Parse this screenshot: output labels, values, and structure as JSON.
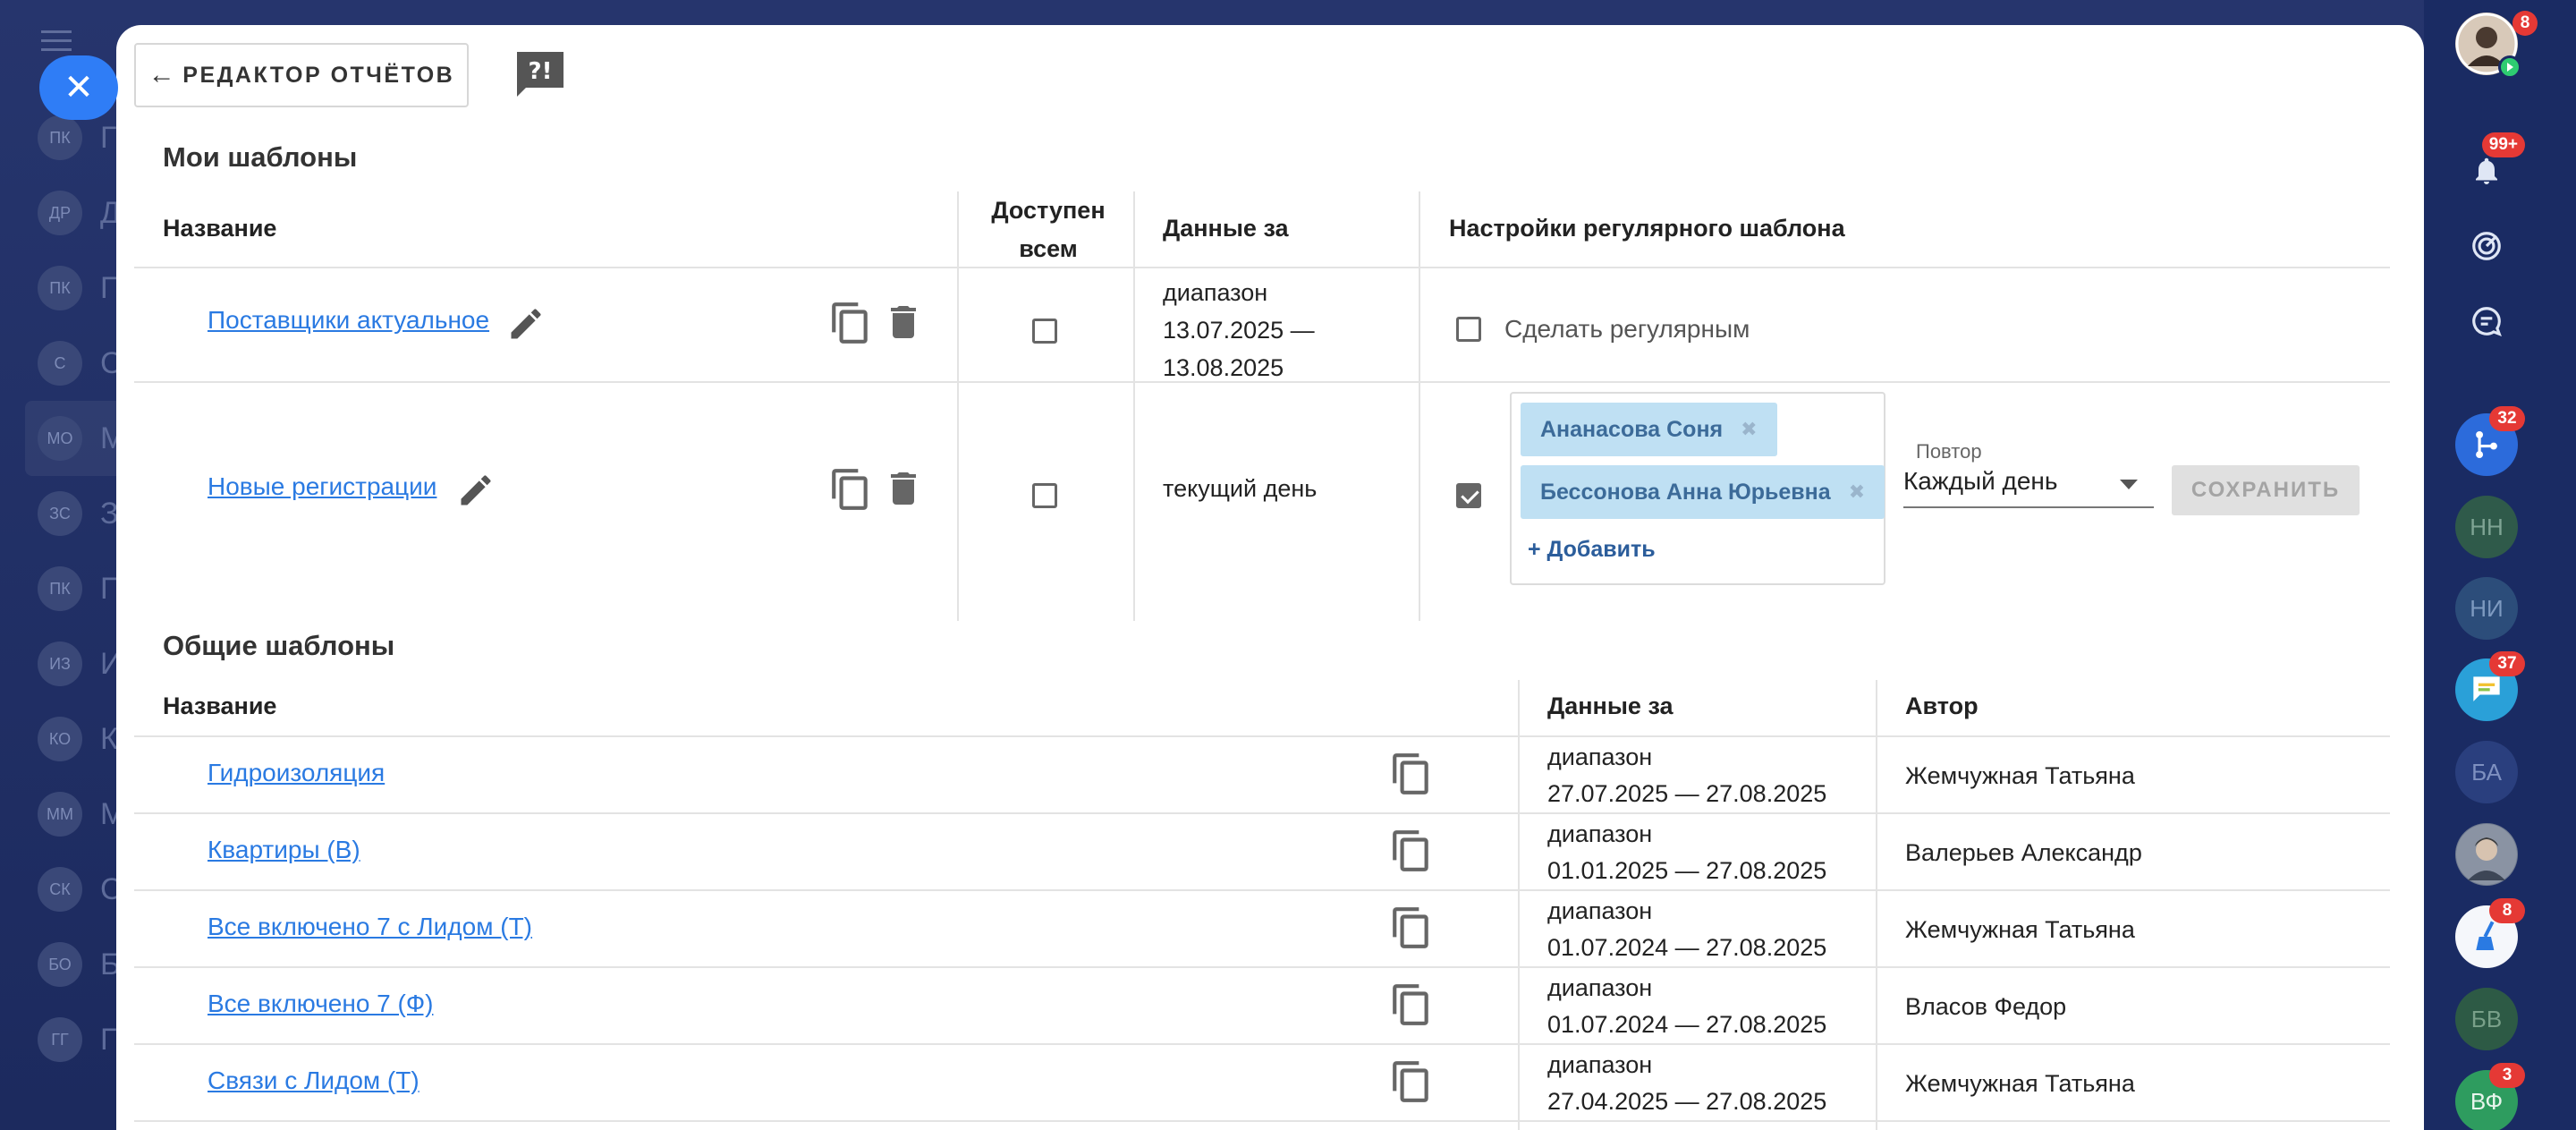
{
  "back_button": {
    "label": "РЕДАКТОР ОТЧЁТОВ"
  },
  "my_templates": {
    "title": "Мои шаблоны",
    "headers": {
      "name": "Название",
      "available": "Доступен всем",
      "data_for": "Данные за",
      "regular": "Настройки регулярного шаблона"
    },
    "rows": [
      {
        "name": "Поставщики актуальное",
        "data_for_lines": [
          "диапазон",
          "13.07.2025 —",
          "13.08.2025"
        ],
        "available": false,
        "regular_checked": false,
        "regular_label": "Сделать регулярным"
      },
      {
        "name": "Новые регистрации ",
        "data_for_lines": [
          "текущий день"
        ],
        "available": false,
        "regular_checked": true,
        "recipients": [
          "Ананасова Соня",
          "Бессонова Анна Юрьевна"
        ],
        "add_label": "+ Добавить",
        "repeat_label": "Повтор",
        "repeat_value": "Каждый день",
        "save_label": "СОХРАНИТЬ"
      }
    ]
  },
  "common_templates": {
    "title": "Общие шаблоны",
    "headers": {
      "name": "Название",
      "data_for": "Данные за",
      "author": "Автор"
    },
    "rows": [
      {
        "name": "Гидроизоляция",
        "range_label": "диапазон",
        "range": "27.07.2025 — 27.08.2025",
        "author": "Жемчужная Татьяна"
      },
      {
        "name": "Квартиры (В)",
        "range_label": "диапазон",
        "range": "01.01.2025 — 27.08.2025",
        "author": "Валерьев Александр"
      },
      {
        "name": "Все включено 7 с Лидом (Т)",
        "range_label": "диапазон",
        "range": "01.07.2024 — 27.08.2025",
        "author": "Жемчужная Татьяна"
      },
      {
        "name": "Все включено 7 (Ф)",
        "range_label": "диапазон",
        "range": "01.07.2024 — 27.08.2025",
        "author": "Власов Федор"
      },
      {
        "name": "Связи с Лидом (Т)",
        "range_label": "диапазон",
        "range": "27.04.2025 — 27.08.2025",
        "author": "Жемчужная Татьяна"
      }
    ]
  },
  "rail": {
    "badges": {
      "notifications": "99+",
      "flows": "32",
      "chat": "37",
      "broom": "8",
      "top_right": "8",
      "last": "3"
    },
    "initials": [
      "НН",
      "НИ",
      "БА",
      "БВ",
      "ВФ"
    ]
  },
  "background_list": [
    "ПК",
    "ДР",
    "ПК",
    "С",
    "МО",
    "ЗС",
    "ПК",
    "ИЗ",
    "КО",
    "ММ",
    "СК",
    "БО",
    "ГГ"
  ]
}
